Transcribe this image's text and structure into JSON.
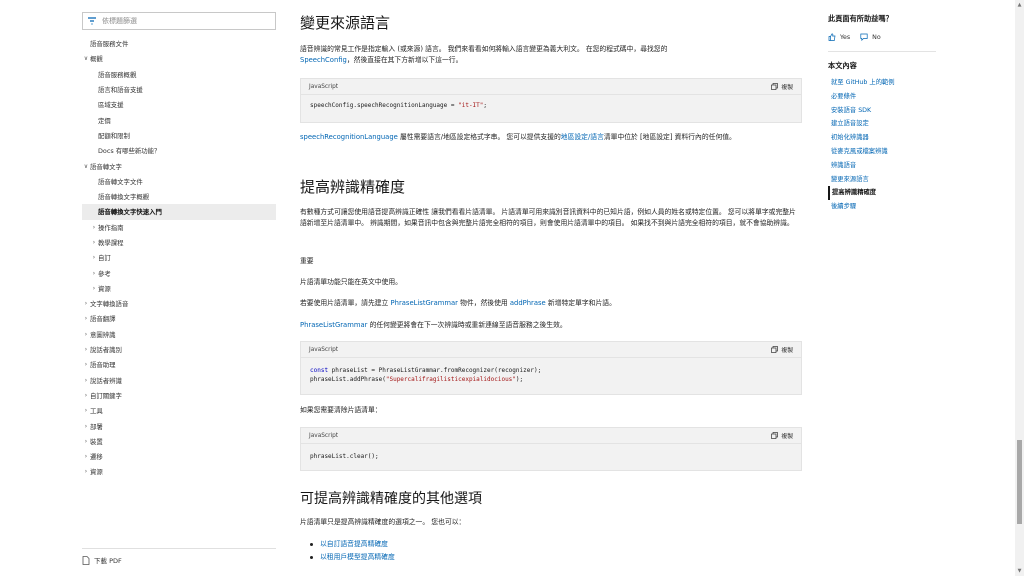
{
  "left_nav": {
    "filter_placeholder": "依標題篩選",
    "items": [
      {
        "label": "語音服務文件",
        "chev": "",
        "indent": 0
      },
      {
        "label": "概觀",
        "chev": "∨",
        "indent": 0
      },
      {
        "label": "語音服務概觀",
        "chev": "",
        "indent": 1
      },
      {
        "label": "語言和語音支援",
        "chev": "",
        "indent": 1
      },
      {
        "label": "區域支援",
        "chev": "",
        "indent": 1
      },
      {
        "label": "定價",
        "chev": "",
        "indent": 1
      },
      {
        "label": "配額和限制",
        "chev": "",
        "indent": 1
      },
      {
        "label": "Docs 有哪些新功能？",
        "chev": "",
        "indent": 1
      },
      {
        "label": "語音轉文字",
        "chev": "∨",
        "indent": 0
      },
      {
        "label": "語音轉文字文件",
        "chev": "",
        "indent": 1
      },
      {
        "label": "語音轉換文字概觀",
        "chev": "",
        "indent": 1
      },
      {
        "label": "語音轉換文字快速入門",
        "chev": "",
        "indent": 1,
        "selected": true
      },
      {
        "label": "操作指南",
        "chev": "›",
        "indent": 1
      },
      {
        "label": "教學課程",
        "chev": "›",
        "indent": 1
      },
      {
        "label": "自訂",
        "chev": "›",
        "indent": 1
      },
      {
        "label": "參考",
        "chev": "›",
        "indent": 1
      },
      {
        "label": "資源",
        "chev": "›",
        "indent": 1
      },
      {
        "label": "文字轉換語音",
        "chev": "›",
        "indent": 0
      },
      {
        "label": "語音翻譯",
        "chev": "›",
        "indent": 0
      },
      {
        "label": "意圖辨識",
        "chev": "›",
        "indent": 0
      },
      {
        "label": "說話者識別",
        "chev": "›",
        "indent": 0
      },
      {
        "label": "語音助理",
        "chev": "›",
        "indent": 0
      },
      {
        "label": "說話者辨識",
        "chev": "›",
        "indent": 0
      },
      {
        "label": "自訂關鍵字",
        "chev": "›",
        "indent": 0
      },
      {
        "label": "工具",
        "chev": "›",
        "indent": 0
      },
      {
        "label": "部署",
        "chev": "›",
        "indent": 0
      },
      {
        "label": "裝置",
        "chev": "›",
        "indent": 0
      },
      {
        "label": "遷移",
        "chev": "›",
        "indent": 0
      },
      {
        "label": "資源",
        "chev": "›",
        "indent": 0
      }
    ],
    "download_pdf": "下載 PDF"
  },
  "main": {
    "section1": {
      "heading": "變更來源語言",
      "p1_a": "語音辨識的常見工作是指定輸入 (或來源) 語言。 我們來看看如何將輸入語言變更為義大利文。 在您的程式碼中，尋找您的",
      "p1_link": "SpeechConfig",
      "p1_b": "，然後直接在其下方新增以下這一行。",
      "code": {
        "lang": "JavaScript",
        "copy": "複製",
        "line1_code": "speechConfig.speechRecognitionLanguage = ",
        "line1_str": "\"it-IT\"",
        "line1_end": ";"
      },
      "p2_link1": "speechRecognitionLanguage",
      "p2_a": " 屬性需要語言/地區設定格式字串。 您可以提供支援的",
      "p2_link2": "地區設定/語言",
      "p2_b": "清單中位於 [地區設定] 資料行內的任何值。"
    },
    "section2": {
      "heading": "提高辨識精確度",
      "p1": "有數種方式可讓您使用語音提高辨識正確性 讓我們看看片語清單。 片語清單可用來識別音訊資料中的已知片語，例如人員的姓名或特定位置。 您可以將單字或完整片語新增至片語清單中。 辨識期間，如果音訊中包含與完整片語完全相符的項目，則會使用片語清單中的項目。 如果找不到與片語完全相符的項目，就不會協助辨識。",
      "important": "重要",
      "note": "片語清單功能只能在英文中使用。",
      "p2_a": "若要使用片語清單，請先建立 ",
      "p2_link1": "PhraseListGrammar",
      "p2_b": " 物件，然後使用 ",
      "p2_link2": "addPhrase",
      "p2_c": " 新增特定單字和片語。",
      "p3_link": "PhraseListGrammar",
      "p3_a": " 的任何變更將會在下一次辨識時或重新連線至語音服務之後生效。",
      "code2": {
        "lang": "JavaScript",
        "copy": "複製",
        "l1_kw": "const",
        "l1_rest": " phraseList = PhraseListGrammar.fromRecognizer(recognizer);",
        "l2_a": "phraseList.addPhrase(",
        "l2_str": "\"Supercalifragilisticexpialidocious\"",
        "l2_b": ");"
      },
      "p4": "如果您需要清除片語清單：",
      "code3": {
        "lang": "JavaScript",
        "copy": "複製",
        "l1": "phraseList.clear();"
      }
    },
    "section3": {
      "heading": "可提高辨識精確度的其他選項",
      "p1": "片語清單只是提高辨識精確度的選項之一。 您也可以：",
      "bullets": [
        "以自訂語音提高精確度",
        "以租用戶模型提高精確度"
      ]
    }
  },
  "right_rail": {
    "helpful_title": "此頁面有所助益嗎？",
    "yes": "Yes",
    "no": "No",
    "in_article_title": "本文內容",
    "items": [
      {
        "label": "就至 GitHub 上的範例",
        "active": false
      },
      {
        "label": "必要條件",
        "active": false
      },
      {
        "label": "安裝語音 SDK",
        "active": false
      },
      {
        "label": "建立語音設定",
        "active": false
      },
      {
        "label": "初始化辨識器",
        "active": false
      },
      {
        "label": "從麥克風或檔案辨識",
        "active": false
      },
      {
        "label": "辨識語音",
        "active": false
      },
      {
        "label": "變更來源語言",
        "active": false
      },
      {
        "label": "提高辨識精確度",
        "active": true
      },
      {
        "label": "後續步驟",
        "active": false
      }
    ]
  },
  "colors": {
    "link": "#0065b3",
    "text": "#171717",
    "code_bg": "#f2f2f2"
  }
}
